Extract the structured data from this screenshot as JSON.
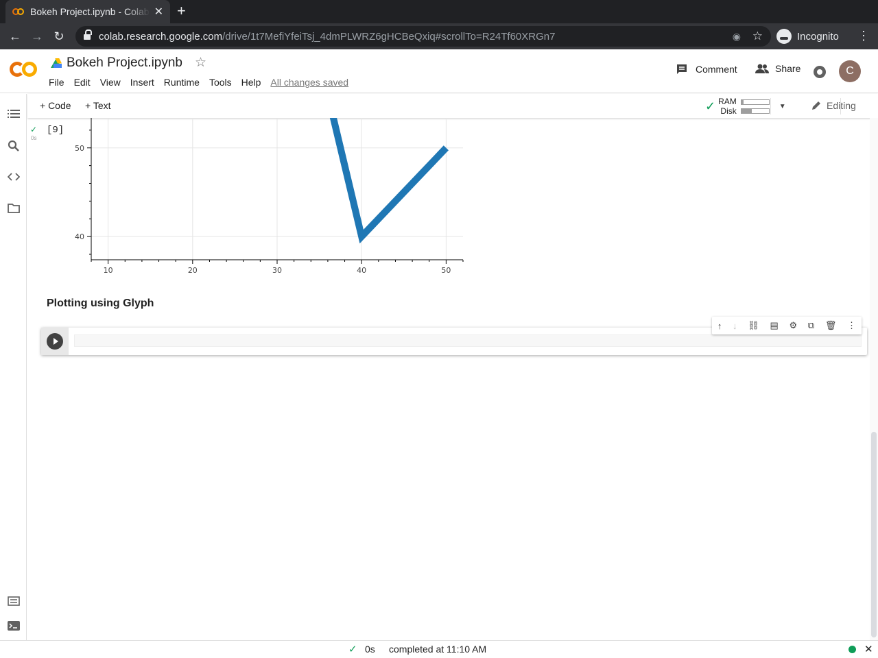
{
  "browser": {
    "tab_title": "Bokeh Project.ipynb - Colab",
    "tab_close": "✕",
    "new_tab": "+",
    "url_host": "colab.research.google.com",
    "url_path": "/drive/1t7MefiYfeiTsj_4dmPLWRZ6gHCBeQxiq#scrollTo=R24Tf60XRGn7",
    "profile_label": "Incognito",
    "back": "←",
    "forward": "→",
    "reload": "↻",
    "menu": "⋮",
    "eye": "◉",
    "bookmark": "☆"
  },
  "colab": {
    "notebook_name": "Bokeh Project.ipynb",
    "star": "☆",
    "menu": [
      "File",
      "Edit",
      "View",
      "Insert",
      "Runtime",
      "Tools",
      "Help"
    ],
    "saved_status": "All changes saved",
    "comment_label": "Comment",
    "share_label": "Share",
    "avatar_letter": "C",
    "add_code": "+ Code",
    "add_text": "+ Text",
    "ram_label": "RAM",
    "disk_label": "Disk",
    "ram_usage": 0.08,
    "disk_usage": 0.38,
    "editing_label": "Editing",
    "collapse": "⌃",
    "dropdown": "▼",
    "check": "✓"
  },
  "rail_icons": [
    "toc-icon",
    "search-icon",
    "code-snippets-icon",
    "files-icon",
    "command-palette-icon",
    "terminal-icon"
  ],
  "cell": {
    "exec_count": "[9]",
    "exec_time": "0s",
    "heading": "Plotting using Glyph"
  },
  "cell_toolbar": [
    "↑",
    "↓",
    "⛓",
    "▤",
    "⚙",
    "⧉",
    "🗑",
    "⋮"
  ],
  "chart_data": {
    "type": "line",
    "x": [
      36,
      40,
      50
    ],
    "y": [
      56,
      40,
      50
    ],
    "xticks": [
      10,
      20,
      30,
      40,
      50
    ],
    "yticks": [
      40,
      50
    ],
    "xlim": [
      8,
      52
    ],
    "ylim": [
      38,
      54
    ],
    "color": "#1f77b4"
  },
  "status": {
    "elapsed": "0s",
    "completed": "completed at 11:10 AM",
    "close": "✕"
  }
}
